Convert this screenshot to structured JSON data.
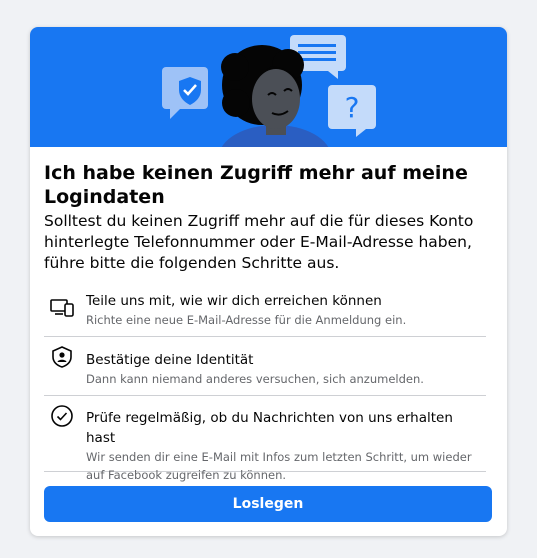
{
  "dialog": {
    "title": "Ich habe keinen Zugriff mehr auf meine Logindaten",
    "intro": "Solltest du keinen Zugriff mehr auf die für dieses Konto hinterlegte Telefonnummer oder E-Mail-Adresse haben, führe bitte die folgenden Schritte aus.",
    "steps": [
      {
        "icon": "devices-icon",
        "title": "Teile uns mit, wie wir dich erreichen können",
        "description": "Richte eine neue E-Mail-Adresse für die Anmeldung ein."
      },
      {
        "icon": "shield-person-icon",
        "title": "Bestätige deine Identität",
        "description": "Dann kann niemand anderes versuchen, sich anzumelden."
      },
      {
        "icon": "check-circle-icon",
        "title": "Prüfe regelmäßig, ob du Nachrichten von uns erhalten hast",
        "description": "Wir senden dir eine E-Mail mit Infos zum letzten Schritt, um wieder auf Facebook zugreifen zu können."
      }
    ],
    "button_label": "Loslegen"
  },
  "colors": {
    "accent": "#1877f2",
    "page_background": "#f0f2f5",
    "primary_text": "#050505",
    "secondary_text": "#65676b",
    "divider": "#ced0d4"
  }
}
